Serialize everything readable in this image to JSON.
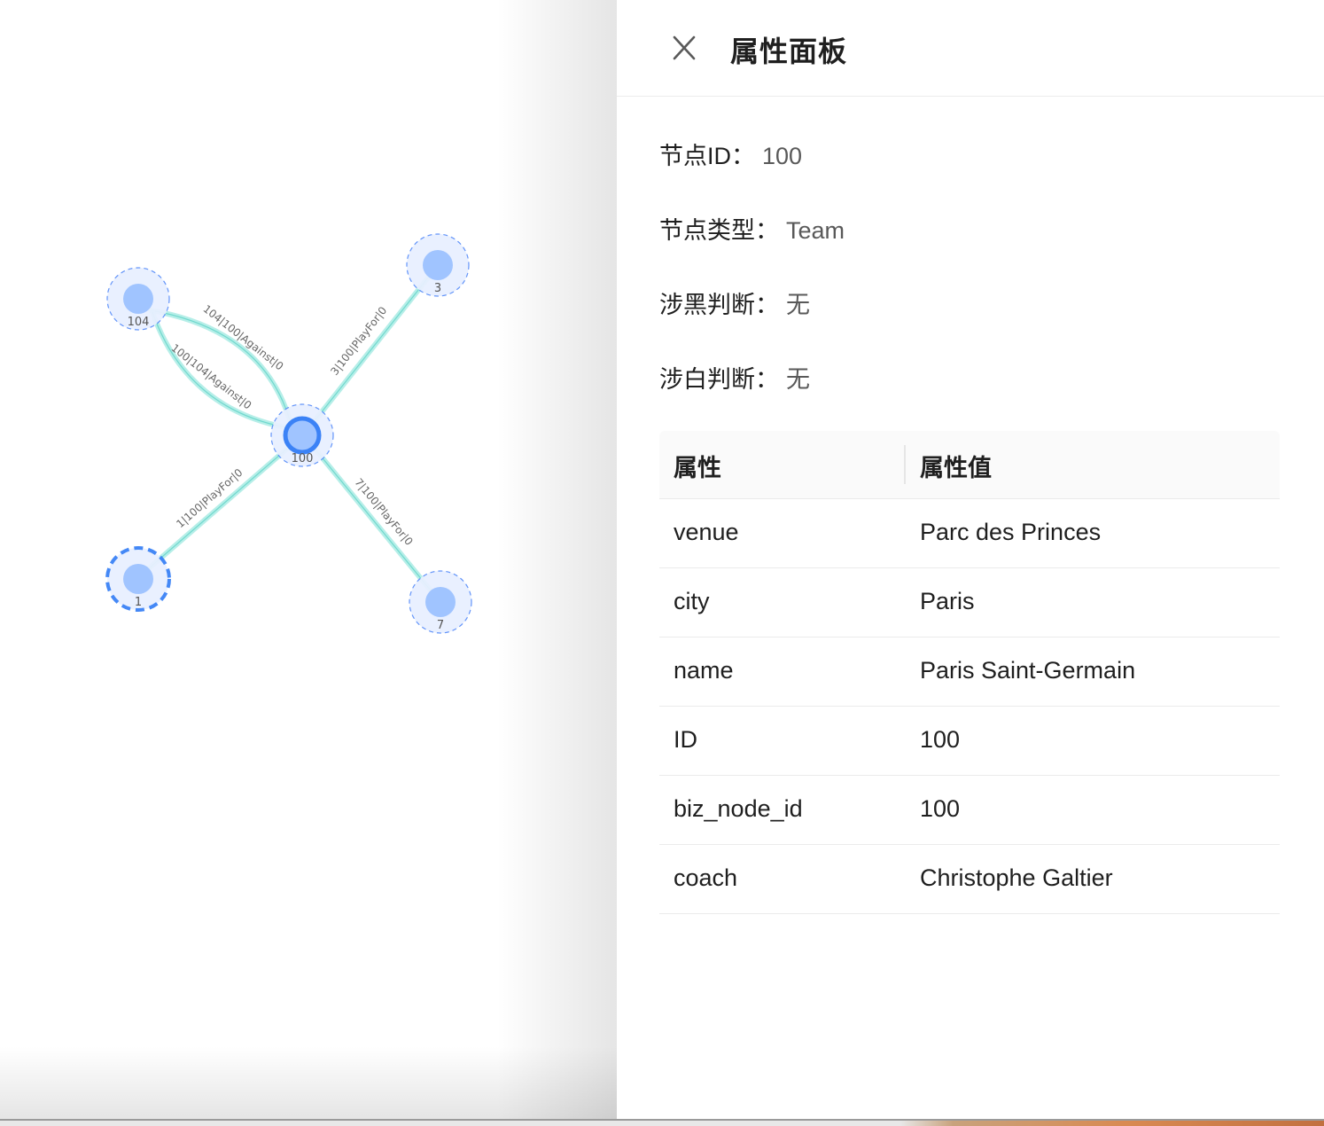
{
  "panel": {
    "title": "属性面板",
    "close_icon": "close-icon"
  },
  "info": {
    "node_id_label": "节点ID：",
    "node_id_value": "100",
    "node_type_label": "节点类型：",
    "node_type_value": "Team",
    "black_label": "涉黑判断：",
    "black_value": "无",
    "white_label": "涉白判断：",
    "white_value": "无"
  },
  "table": {
    "headers": [
      "属性",
      "属性值"
    ],
    "rows": [
      [
        "venue",
        "Parc des Princes"
      ],
      [
        "city",
        "Paris"
      ],
      [
        "name",
        "Paris Saint-Germain"
      ],
      [
        "ID",
        "100"
      ],
      [
        "biz_node_id",
        "100"
      ],
      [
        "coach",
        "Christophe Galtier"
      ]
    ]
  },
  "graph": {
    "nodes": [
      {
        "id": "100",
        "label": "100",
        "selected": true
      },
      {
        "id": "104",
        "label": "104"
      },
      {
        "id": "3",
        "label": "3"
      },
      {
        "id": "1",
        "label": "1",
        "hovered": true
      },
      {
        "id": "7",
        "label": "7"
      }
    ],
    "edges": [
      {
        "source": "104",
        "target": "100",
        "label": "104|100|Against|0"
      },
      {
        "source": "100",
        "target": "104",
        "label": "100|104|Against|0"
      },
      {
        "source": "3",
        "target": "100",
        "label": "3|100|PlayFor|0"
      },
      {
        "source": "1",
        "target": "100",
        "label": "1|100|PlayFor|0"
      },
      {
        "source": "7",
        "target": "100",
        "label": "7|100|PlayFor|0"
      }
    ],
    "colors": {
      "node_fill": "#a0c4ff",
      "node_halo": "#e8f0ff",
      "node_stroke": "#5b8ff9",
      "selected_stroke": "#3b82f6",
      "edge": "#9ee8e0",
      "edge_label": "#666666"
    }
  }
}
